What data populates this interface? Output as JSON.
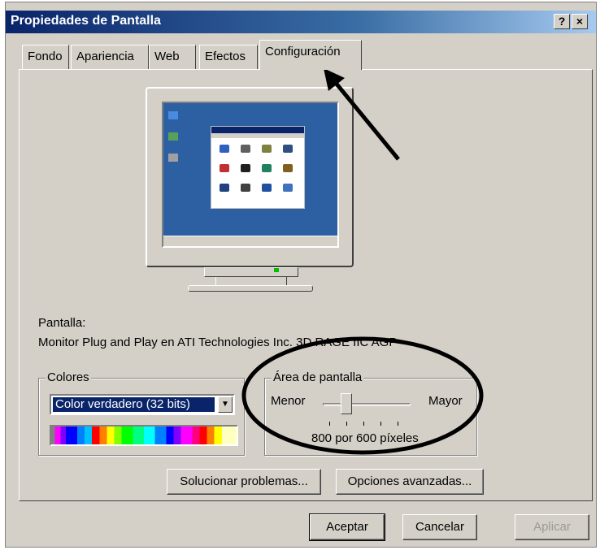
{
  "window": {
    "title": "Propiedades de Pantalla",
    "help_button": "?",
    "close_button": "×"
  },
  "tabs": [
    {
      "label": "Fondo"
    },
    {
      "label": "Apariencia"
    },
    {
      "label": "Web"
    },
    {
      "label": "Efectos"
    },
    {
      "label": "Configuración",
      "active": true
    }
  ],
  "display": {
    "label": "Pantalla:",
    "device": "Monitor Plug and Play en ATI Technologies Inc. 3D RAGE IIC AGP"
  },
  "colors_group": {
    "label": "Colores",
    "selected": "Color verdadero (32 bits)"
  },
  "screen_area_group": {
    "label": "Área de pantalla",
    "min_label": "Menor",
    "max_label": "Mayor",
    "value_text": "800 por 600 píxeles",
    "slider_position_fraction": 0.25
  },
  "buttons": {
    "troubleshoot": "Solucionar problemas...",
    "advanced": "Opciones avanzadas...",
    "ok": "Aceptar",
    "cancel": "Cancelar",
    "apply": "Aplicar"
  },
  "colors": {
    "titlebar": "#0a246a",
    "face": "#d4d0c8",
    "desktop": "#2d5fa3"
  }
}
